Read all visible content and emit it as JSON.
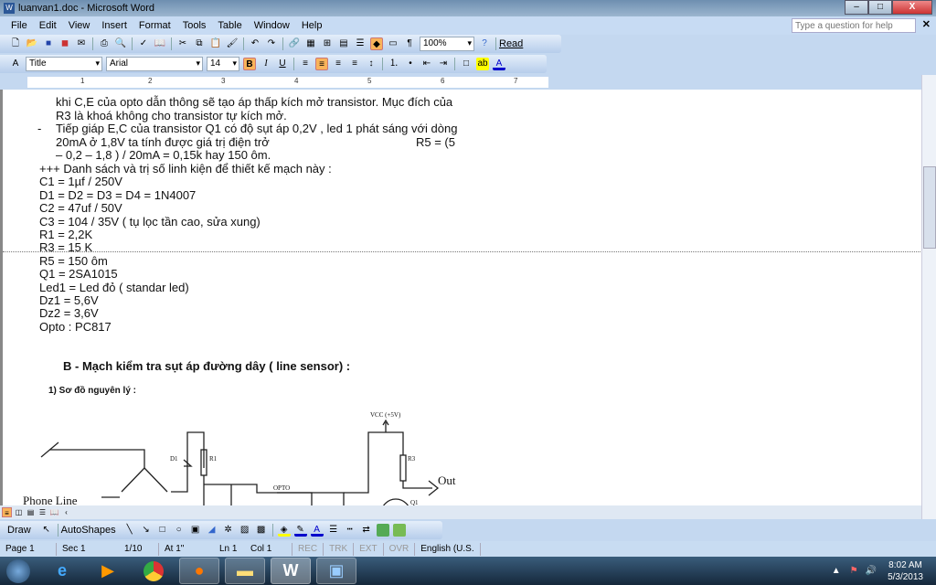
{
  "window": {
    "title": "luanvan1.doc - Microsoft Word",
    "minimize": "–",
    "maximize": "□",
    "close": "X"
  },
  "menu": [
    "File",
    "Edit",
    "View",
    "Insert",
    "Format",
    "Tools",
    "Table",
    "Window",
    "Help"
  ],
  "help": {
    "placeholder": "Type a question for help"
  },
  "standard": {
    "zoom": "100%",
    "read": "Read"
  },
  "formatting": {
    "style": "Title",
    "font": "Arial",
    "size": "14",
    "bold": "B",
    "italic": "I",
    "underline": "U"
  },
  "ruler": [
    "1",
    "2",
    "3",
    "4",
    "5",
    "6",
    "7"
  ],
  "doc": {
    "lines": [
      "khi C,E của opto dẫn thông sẽ tạo áp thấp kích mở transistor. Mục đích của",
      "R3 là khoá không cho transistor tự kích mở.",
      "-",
      "Tiếp giáp E,C của transistor Q1 có độ sụt áp 0,2V , led 1 phát sáng với dòng",
      "20mA ở 1,8V ta tính được  giá trị điện trở",
      "R5 = (5",
      "– 0,2 – 1,8 ) / 20mA  = 0,15k    hay 150 ôm.",
      "+++ Danh sách và trị số linh kiện để thiết kế mạch này :",
      "C1 = 1µf / 250V",
      "D1 = D2 = D3 = D4 = 1N4007",
      "C2  = 47uf / 50V",
      "C3 = 104 / 35V  ( tụ lọc tần cao, sửa xung)",
      "R1 = 2,2K",
      "R3 = 15 K",
      "R5 = 150 ôm",
      "Q1 = 2SA1015",
      "Led1 = Led đỏ ( standar led)",
      "Dz1 = 5,6V",
      "Dz2 = 3,6V",
      "Opto : PC817"
    ],
    "heading": "B - Mạch kiểm tra sụt áp đường dây ( line sensor) :",
    "subheading": "1) Sơ đồ nguyên lý :",
    "circuit": {
      "phone": "Phone Line",
      "vcc": "VCC (+5V)",
      "out": "Out",
      "d1": "D1",
      "r1": "R1",
      "r3": "R3",
      "opto": "OPTO",
      "q1": "Q1"
    }
  },
  "draw": {
    "draw": "Draw",
    "autoshapes": "AutoShapes"
  },
  "status": {
    "page": "Page 1",
    "sec": "Sec 1",
    "of": "1/10",
    "at": "At 1\"",
    "ln": "Ln 1",
    "col": "Col 1",
    "rec": "REC",
    "trk": "TRK",
    "ext": "EXT",
    "ovr": "OVR",
    "lang": "English (U.S."
  },
  "tray": {
    "time": "8:02 AM",
    "date": "5/3/2013"
  }
}
